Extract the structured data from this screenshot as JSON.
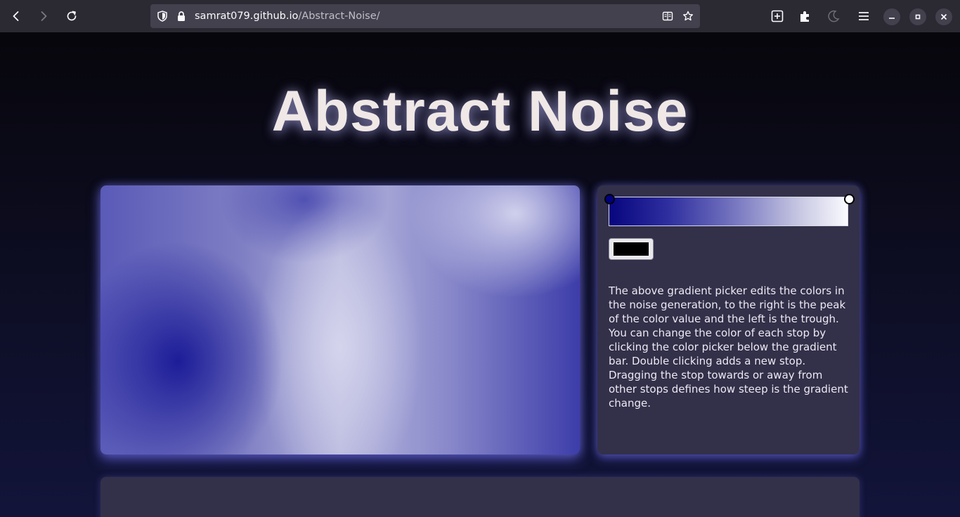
{
  "browser": {
    "url_domain": "samrat079.github.io",
    "url_path": "/Abstract-Noise/"
  },
  "page": {
    "title": "Abstract Noise"
  },
  "gradient_picker": {
    "stops": [
      {
        "position": 0.0,
        "color": "#000080"
      },
      {
        "position": 1.0,
        "color": "#ffffff"
      }
    ],
    "selected_color": "#000000",
    "description": "The above gradient picker edits the colors in the noise generation, to the right is the peak of the color value and the left is the trough. You can change the color of each stop by clicking the color picker below the gradient bar. Double clicking adds a new stop. Dragging the stop towards or away from other stops defines how steep is the gradient change."
  },
  "colors": {
    "chrome": "#2b2a33",
    "urlbar": "#42414d",
    "panel": "#33304a",
    "title": "#efe8e6"
  }
}
